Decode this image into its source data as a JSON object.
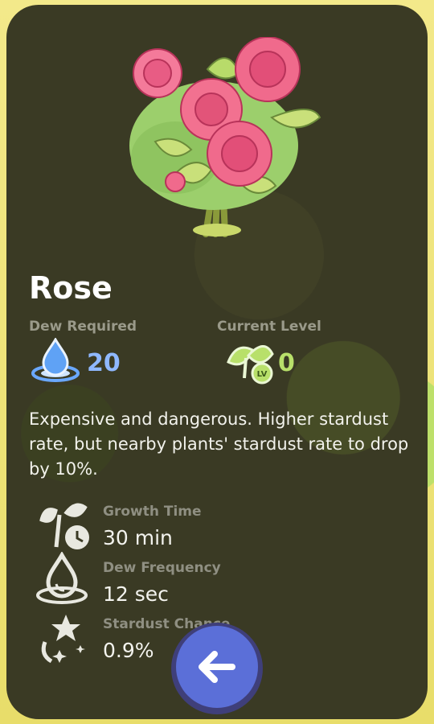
{
  "plant": {
    "name": "Rose",
    "description": "Expensive and dangerous. Higher stardust rate, but nearby plants' stardust rate to drop by 10%."
  },
  "summary": {
    "dew_required_label": "Dew Required",
    "dew_required_value": "20",
    "current_level_label": "Current Level",
    "current_level_value": "0",
    "level_badge": "LV"
  },
  "stats": [
    {
      "label": "Growth Time",
      "value": "30 min",
      "icon": "sprout-clock-icon"
    },
    {
      "label": "Dew Frequency",
      "value": "12 sec",
      "icon": "dew-drop-icon"
    },
    {
      "label": "Stardust Chance",
      "value": "0.9%",
      "icon": "stardust-icon"
    }
  ],
  "colors": {
    "dew_value": "#8fb8ff",
    "level_value": "#b8e06a",
    "button": "#5b6fd8"
  },
  "back_button": {
    "icon": "arrow-left-icon"
  }
}
